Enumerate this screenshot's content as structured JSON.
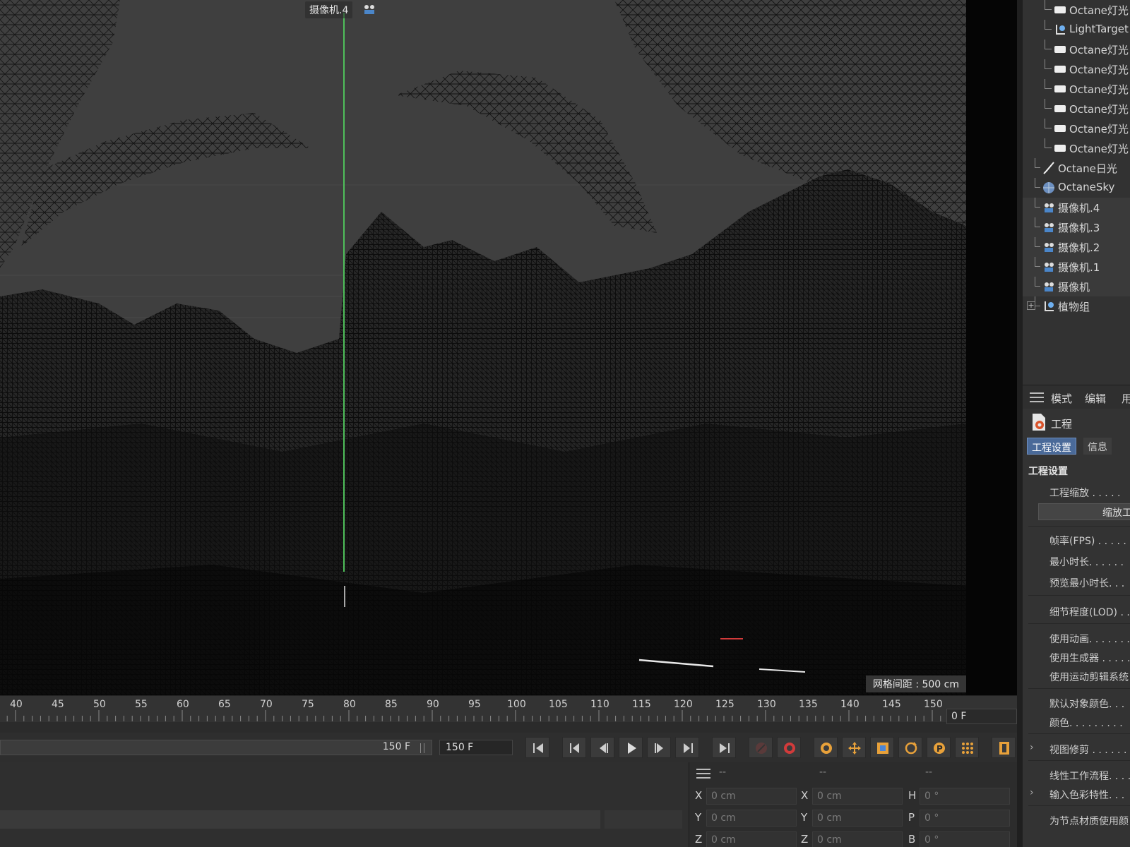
{
  "viewport": {
    "camera_label": "摄像机.4",
    "grid_spacing": "网格间距 : 500 cm"
  },
  "object_manager": {
    "items": [
      {
        "label": "Octane灯光",
        "icon": "area-light-icon"
      },
      {
        "label": "LightTarget",
        "icon": "light-target-icon"
      },
      {
        "label": "Octane灯光",
        "icon": "area-light-icon"
      },
      {
        "label": "Octane灯光",
        "icon": "area-light-icon"
      },
      {
        "label": "Octane灯光",
        "icon": "area-light-icon"
      },
      {
        "label": "Octane灯光",
        "icon": "area-light-icon"
      },
      {
        "label": "Octane灯光",
        "icon": "area-light-icon"
      },
      {
        "label": "Octane灯光",
        "icon": "area-light-icon"
      },
      {
        "label": "Octane日光",
        "icon": "daylight-icon"
      },
      {
        "label": "OctaneSky",
        "icon": "sky-icon"
      },
      {
        "label": "摄像机.4",
        "icon": "camera-icon"
      },
      {
        "label": "摄像机.3",
        "icon": "camera-icon"
      },
      {
        "label": "摄像机.2",
        "icon": "camera-icon"
      },
      {
        "label": "摄像机.1",
        "icon": "camera-icon"
      },
      {
        "label": "摄像机",
        "icon": "camera-icon"
      },
      {
        "label": "植物组",
        "icon": "null-group-icon"
      }
    ]
  },
  "attributes": {
    "menu": [
      "模式",
      "编辑",
      "用"
    ],
    "title": "工程",
    "tabs": [
      "工程设置",
      "信息"
    ],
    "section_title": "工程设置",
    "scale_label": "工程缩放 . . . . .",
    "scale_button": "缩放工",
    "fps_label": "帧率(FPS) . . . . .",
    "min_time_label": "最小时长. . . . . .",
    "preview_min_label": "预览最小时长. . .",
    "lod_label": "细节程度(LOD) . .",
    "use_anim_label": "使用动画. . . . . . .",
    "use_gen_label": "使用生成器 . . . . .",
    "use_motion_label": "使用运动剪辑系统",
    "default_color_label": "默认对象颜色. . .",
    "color_label": "颜色. . . . . . . . .",
    "view_clip_label": "视图修剪 . . . . . .",
    "linear_label": "线性工作流程. . . .",
    "input_color_label": "输入色彩特性. . .",
    "node_mat_label": "为节点材质使用颜"
  },
  "timeline": {
    "ticks": [
      "40",
      "45",
      "50",
      "55",
      "60",
      "65",
      "70",
      "75",
      "80",
      "85",
      "90",
      "95",
      "100",
      "105",
      "110",
      "115",
      "120",
      "125",
      "130",
      "135",
      "140",
      "145",
      "150"
    ],
    "current_frame": "0 F"
  },
  "transport": {
    "range_end": "150 F",
    "end_frame": "150 F"
  },
  "coordinates": {
    "headers": [
      "--",
      "--",
      "--"
    ],
    "rows": [
      {
        "a1": "X",
        "v1": "0 cm",
        "a2": "X",
        "v2": "0 cm",
        "a3": "H",
        "v3": "0 °"
      },
      {
        "a1": "Y",
        "v1": "0 cm",
        "a2": "Y",
        "v2": "0 cm",
        "a3": "P",
        "v3": "0 °"
      },
      {
        "a1": "Z",
        "v1": "0 cm",
        "a2": "Z",
        "v2": "0 cm",
        "a3": "B",
        "v3": "0 °"
      }
    ]
  },
  "colors": {
    "viewport_bg": "#3f3f3f",
    "camera_axis": "#4fbf5a",
    "selection_tab": "#4a6a99",
    "record_red": "#d23b3b",
    "tool_blue": "#4c86d6",
    "tool_orange": "#e8a13a"
  }
}
